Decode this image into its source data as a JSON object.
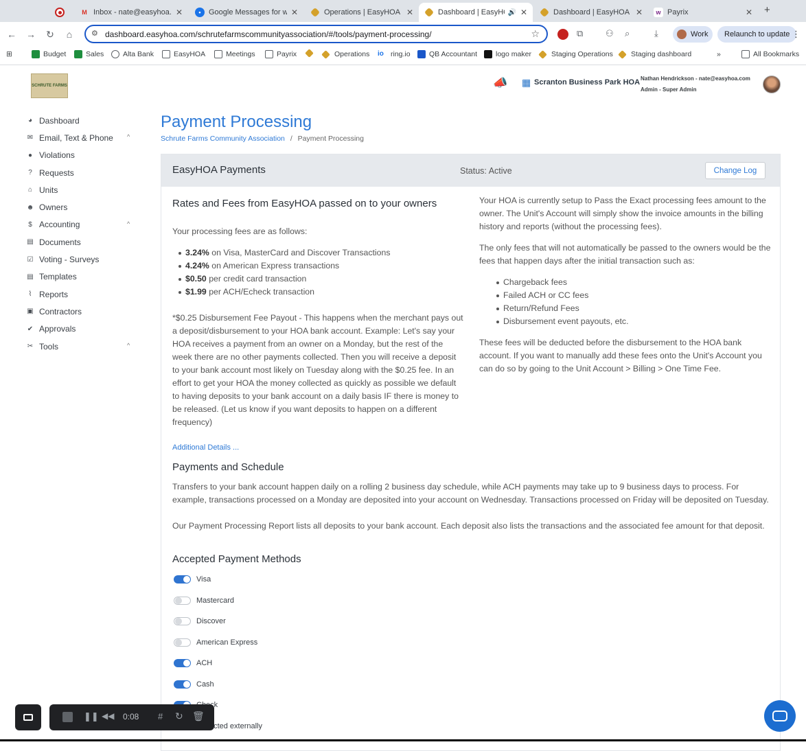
{
  "browser": {
    "tabs": [
      {
        "title": "",
        "favicon": "recording-dot-icon",
        "close": ""
      },
      {
        "title": "Inbox - nate@easyhoa.co",
        "favicon": "gmail-icon",
        "close": "✕"
      },
      {
        "title": "Google Messages for we",
        "favicon": "messages-icon",
        "close": "✕"
      },
      {
        "title": "Operations | EasyHOA",
        "favicon": "easyhoa-icon",
        "close": "✕"
      },
      {
        "title": "Dashboard | EasyHO",
        "favicon": "easyhoa-icon",
        "close": "✕"
      },
      {
        "title": "Dashboard | EasyHOA",
        "favicon": "easyhoa-icon",
        "close": "✕"
      },
      {
        "title": "Payrix",
        "favicon": "payrix-icon",
        "close": "✕"
      }
    ],
    "new_tab": "+",
    "url": "dashboard.easyhoa.com/schrutefarmscommunityassociation/#/tools/payment-processing/",
    "profile": "Work",
    "relaunch": "Relaunch to update",
    "bookmarks": [
      {
        "label": "Budget",
        "color": "#1e8e3e"
      },
      {
        "label": "Sales",
        "color": "#1e8e3e"
      },
      {
        "label": "Alta Bank",
        "color": "#5f6368"
      },
      {
        "label": "EasyHOA",
        "color": "folder"
      },
      {
        "label": "Meetings",
        "color": "folder"
      },
      {
        "label": "Payrix",
        "color": "folder"
      },
      {
        "label": "",
        "color": "#d4a12a"
      },
      {
        "label": "Operations",
        "color": "#d4a12a"
      },
      {
        "label": "ring.io",
        "color": "#1a73e8"
      },
      {
        "label": "QB Accountant",
        "color": "#1a57c9"
      },
      {
        "label": "logo maker",
        "color": "#111111"
      },
      {
        "label": "Staging Operations",
        "color": "#d4a12a"
      },
      {
        "label": "Staging dashboard",
        "color": "#d4a12a"
      }
    ],
    "bookmarks_more": "»",
    "all_bookmarks": "All Bookmarks"
  },
  "header": {
    "hoa_name": "Scranton Business Park HOA",
    "user": "Nathan Hendrickson - nate@easyhoa.com",
    "role": "Admin - Super Admin"
  },
  "logo_text": "SCHRUTE FARMS",
  "sidebar": {
    "items": [
      {
        "label": "Dashboard",
        "icon": "dashboard-icon",
        "glyph": "◕",
        "chevron": ""
      },
      {
        "label": "Email, Text & Phone",
        "icon": "email-icon",
        "glyph": "✉",
        "chevron": "^"
      },
      {
        "label": "Violations",
        "icon": "alert-icon",
        "glyph": "●",
        "chevron": ""
      },
      {
        "label": "Requests",
        "icon": "question-icon",
        "glyph": "?",
        "chevron": ""
      },
      {
        "label": "Units",
        "icon": "home-icon",
        "glyph": "⌂",
        "chevron": ""
      },
      {
        "label": "Owners",
        "icon": "users-icon",
        "glyph": "☻",
        "chevron": ""
      },
      {
        "label": "Accounting",
        "icon": "dollar-icon",
        "glyph": "$",
        "chevron": "^"
      },
      {
        "label": "Documents",
        "icon": "document-icon",
        "glyph": "▤",
        "chevron": ""
      },
      {
        "label": "Voting - Surveys",
        "icon": "ballot-icon",
        "glyph": "☑",
        "chevron": ""
      },
      {
        "label": "Templates",
        "icon": "template-icon",
        "glyph": "▤",
        "chevron": ""
      },
      {
        "label": "Reports",
        "icon": "chart-icon",
        "glyph": "⌇",
        "chevron": ""
      },
      {
        "label": "Contractors",
        "icon": "contractor-icon",
        "glyph": "▣",
        "chevron": ""
      },
      {
        "label": "Approvals",
        "icon": "check-circle-icon",
        "glyph": "✔",
        "chevron": ""
      },
      {
        "label": "Tools",
        "icon": "tools-icon",
        "glyph": "✂",
        "chevron": "^"
      }
    ]
  },
  "page": {
    "title": "Payment Processing",
    "breadcrumb_link": "Schrute Farms Community Association",
    "breadcrumb_sep": "/",
    "breadcrumb_current": "Payment Processing"
  },
  "card": {
    "title": "EasyHOA Payments",
    "status": "Status: Active",
    "change_log": "Change Log",
    "rates_heading": "Rates and Fees from EasyHOA passed on to your owners",
    "fees_intro": "Your processing fees are as follows:",
    "fees": [
      {
        "bold": "3.24%",
        "text": " on Visa, MasterCard and Discover Transactions"
      },
      {
        "bold": "4.24%",
        "text": " on American Express transactions"
      },
      {
        "bold": "$0.50",
        "text": " per credit card transaction"
      },
      {
        "bold": "$1.99",
        "text": " per ACH/Echeck transaction"
      }
    ],
    "disbursement_note": "*$0.25 Disbursement Fee Payout - This happens when the merchant pays out a deposit/disbursement to your HOA bank account. Example: Let's say your HOA receives a payment from an owner on a Monday, but the rest of the week there are no other payments collected. Then you will receive a deposit to your bank account most likely on Tuesday along with the $0.25 fee. In an effort to get your HOA the money collected as quickly as possible we default to having deposits to your bank account on a daily basis IF there is money to be released. (Let us know if you want deposits to happen on a different frequency)",
    "additional_details": "Additional Details ...",
    "right_p1": "Your HOA is currently setup to Pass the Exact processing fees amount to the owner. The Unit's Account will simply show the invoice amounts in the billing history and reports (without the processing fees).",
    "right_p2": "The only fees that will not automatically be passed to the owners would be the fees that happen days after the initial transaction such as:",
    "right_list": [
      "Chargeback fees",
      "Failed ACH or CC fees",
      "Return/Refund Fees",
      "Disbursement event payouts, etc."
    ],
    "right_p3": "These fees will be deducted before the disbursement to the HOA bank account. If you want to manually add these fees onto the Unit's Account you can do so by going to the Unit Account > Billing > One Time Fee.",
    "schedule_heading": "Payments and Schedule",
    "schedule_p1": "Transfers to your bank account happen daily on a rolling 2 business day schedule, while ACH payments may take up to 9 business days to process. For example, transactions processed on a Monday are deposited into your account on Wednesday. Transactions processed on Friday will be deposited on Tuesday.",
    "schedule_p2": "Our Payment Processing Report lists all deposits to your bank account. Each deposit also lists the transactions and the associated fee amount for that deposit.",
    "methods_heading": "Accepted Payment Methods",
    "methods": [
      {
        "label": "Visa",
        "on": true
      },
      {
        "label": "Mastercard",
        "on": false
      },
      {
        "label": "Discover",
        "on": false
      },
      {
        "label": "American Express",
        "on": false
      },
      {
        "label": "ACH",
        "on": true
      },
      {
        "label": "Cash",
        "on": true
      },
      {
        "label": "Check",
        "on": true
      },
      {
        "label": "Collected externally",
        "on": false
      }
    ]
  },
  "recorder": {
    "time": "0:08"
  },
  "colors": {
    "accent": "#2f7ad6",
    "toggle_on": "#2f74d0",
    "chat": "#1c6dd0"
  }
}
